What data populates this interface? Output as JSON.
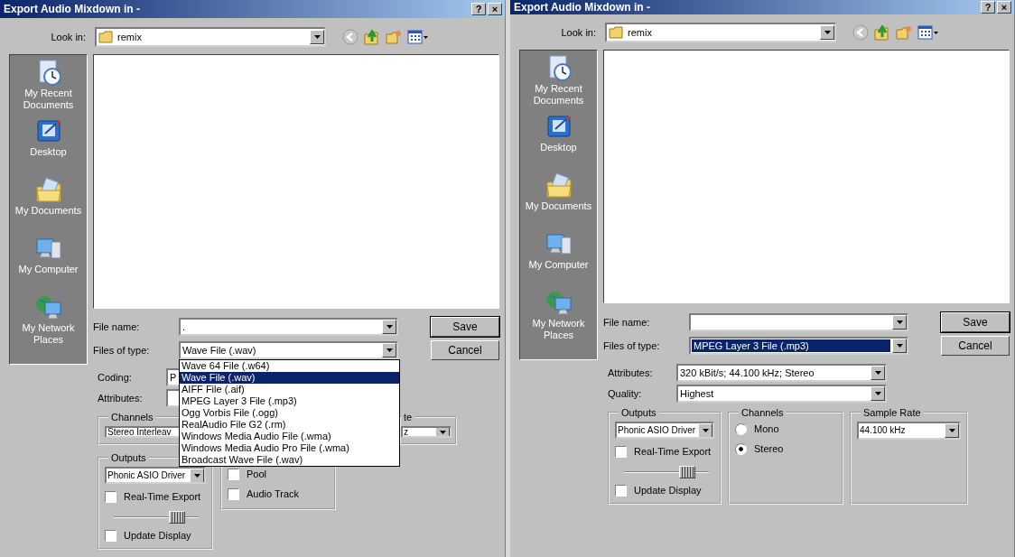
{
  "dialogs": [
    {
      "title": "Export Audio Mixdown in -",
      "title_buttons": [
        "?",
        "×"
      ],
      "look_in": {
        "label": "Look in:",
        "value": "remix"
      },
      "places": [
        {
          "kind": "recent",
          "label": "My Recent Documents"
        },
        {
          "kind": "desktop",
          "label": "Desktop"
        },
        {
          "kind": "documents",
          "label": "My Documents"
        },
        {
          "kind": "computer",
          "label": "My Computer"
        },
        {
          "kind": "network",
          "label": "My Network Places"
        }
      ],
      "file_name": {
        "label": "File name:",
        "value": "."
      },
      "file_type": {
        "label": "Files of type:",
        "value": "Wave File (.wav)",
        "highlighted": false
      },
      "buttons": [
        "Save",
        "Cancel"
      ],
      "fields": [
        {
          "kind": "field",
          "label": "Coding:",
          "value": "P"
        },
        {
          "kind": "field",
          "label": "Attributes:"
        }
      ],
      "group_rows": [
        [
          {
            "title": "Channels",
            "items": [
              {
                "kind": "field",
                "value": "Stereo Interleav"
              }
            ]
          },
          {
            "title": "te",
            "items": [
              {
                "kind": "combo",
                "value": "z"
              }
            ]
          }
        ],
        [
          {
            "title": "Outputs",
            "items": [
              {
                "kind": "combo",
                "value": "Phonic ASIO Driver"
              },
              {
                "kind": "check",
                "label": "Real-Time Export",
                "checked": false
              },
              {
                "kind": "slider",
                "level": 0.8
              },
              {
                "kind": "check",
                "label": "Update Display",
                "checked": false
              }
            ]
          },
          {
            "items": [
              {
                "kind": "check",
                "label": "Pool",
                "checked": false
              },
              {
                "kind": "check",
                "label": "Audio Track",
                "checked": false
              }
            ]
          }
        ]
      ],
      "type_list": [
        {
          "label": "Wave 64 File (.w64)",
          "selected": false
        },
        {
          "label": "Wave File (.wav)",
          "selected": true
        },
        {
          "label": "AIFF File (.aif)",
          "selected": false
        },
        {
          "label": "MPEG Layer 3 File (.mp3)",
          "selected": false
        },
        {
          "label": "Ogg Vorbis File (.ogg)",
          "selected": false
        },
        {
          "label": "RealAudio File G2 (.rm)",
          "selected": false
        },
        {
          "label": "Windows Media Audio File (.wma)",
          "selected": false
        },
        {
          "label": "Windows Media Audio Pro File (.wma)",
          "selected": false
        },
        {
          "label": "Broadcast Wave File (.wav)",
          "selected": false
        }
      ]
    },
    {
      "title": "Export Audio Mixdown in -",
      "title_buttons": [
        "?",
        "×"
      ],
      "look_in": {
        "label": "Look in:",
        "value": "remix"
      },
      "places": [
        {
          "kind": "recent",
          "label": "My Recent Documents"
        },
        {
          "kind": "desktop",
          "label": "Desktop"
        },
        {
          "kind": "documents",
          "label": "My Documents"
        },
        {
          "kind": "computer",
          "label": "My Computer"
        },
        {
          "kind": "network",
          "label": "My Network Places"
        }
      ],
      "file_name": {
        "label": "File name:"
      },
      "file_type": {
        "label": "Files of type:",
        "value": "MPEG Layer 3 File (.mp3)",
        "highlighted": true
      },
      "buttons": [
        "Save",
        "Cancel"
      ],
      "fields": [
        {
          "kind": "combo",
          "label": "Attributes:",
          "value": "320 kBit/s; 44.100 kHz; Stereo"
        },
        {
          "kind": "combo",
          "label": "Quality:",
          "value": "Highest"
        }
      ],
      "group_rows": [
        [
          {
            "title": "Outputs",
            "items": [
              {
                "kind": "combo",
                "value": "Phonic ASIO Driver"
              },
              {
                "kind": "check",
                "label": "Real-Time Export",
                "checked": false
              },
              {
                "kind": "slider",
                "level": 0.8
              },
              {
                "kind": "check",
                "label": "Update Display",
                "checked": false
              }
            ]
          },
          {
            "title": "Channels",
            "items": [
              {
                "kind": "radio",
                "label": "Mono",
                "selected": false
              },
              {
                "kind": "radio",
                "label": "Stereo",
                "selected": true
              }
            ]
          },
          {
            "title": "Sample Rate",
            "items": [
              {
                "kind": "combo",
                "value": "44.100 kHz"
              }
            ]
          }
        ]
      ]
    }
  ]
}
